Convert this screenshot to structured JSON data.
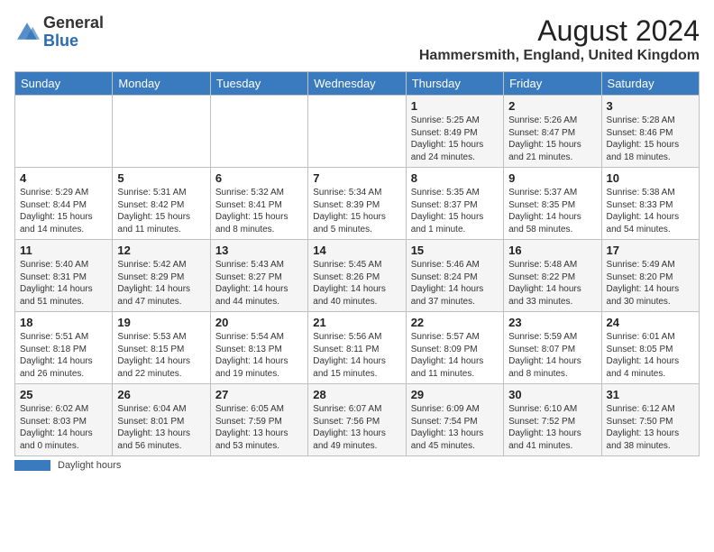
{
  "header": {
    "logo_general": "General",
    "logo_blue": "Blue",
    "month_year": "August 2024",
    "location": "Hammersmith, England, United Kingdom"
  },
  "days_of_week": [
    "Sunday",
    "Monday",
    "Tuesday",
    "Wednesday",
    "Thursday",
    "Friday",
    "Saturday"
  ],
  "footer": {
    "legend_label": "Daylight hours"
  },
  "weeks": [
    [
      {
        "day": "",
        "info": ""
      },
      {
        "day": "",
        "info": ""
      },
      {
        "day": "",
        "info": ""
      },
      {
        "day": "",
        "info": ""
      },
      {
        "day": "1",
        "info": "Sunrise: 5:25 AM\nSunset: 8:49 PM\nDaylight: 15 hours\nand 24 minutes."
      },
      {
        "day": "2",
        "info": "Sunrise: 5:26 AM\nSunset: 8:47 PM\nDaylight: 15 hours\nand 21 minutes."
      },
      {
        "day": "3",
        "info": "Sunrise: 5:28 AM\nSunset: 8:46 PM\nDaylight: 15 hours\nand 18 minutes."
      }
    ],
    [
      {
        "day": "4",
        "info": "Sunrise: 5:29 AM\nSunset: 8:44 PM\nDaylight: 15 hours\nand 14 minutes."
      },
      {
        "day": "5",
        "info": "Sunrise: 5:31 AM\nSunset: 8:42 PM\nDaylight: 15 hours\nand 11 minutes."
      },
      {
        "day": "6",
        "info": "Sunrise: 5:32 AM\nSunset: 8:41 PM\nDaylight: 15 hours\nand 8 minutes."
      },
      {
        "day": "7",
        "info": "Sunrise: 5:34 AM\nSunset: 8:39 PM\nDaylight: 15 hours\nand 5 minutes."
      },
      {
        "day": "8",
        "info": "Sunrise: 5:35 AM\nSunset: 8:37 PM\nDaylight: 15 hours\nand 1 minute."
      },
      {
        "day": "9",
        "info": "Sunrise: 5:37 AM\nSunset: 8:35 PM\nDaylight: 14 hours\nand 58 minutes."
      },
      {
        "day": "10",
        "info": "Sunrise: 5:38 AM\nSunset: 8:33 PM\nDaylight: 14 hours\nand 54 minutes."
      }
    ],
    [
      {
        "day": "11",
        "info": "Sunrise: 5:40 AM\nSunset: 8:31 PM\nDaylight: 14 hours\nand 51 minutes."
      },
      {
        "day": "12",
        "info": "Sunrise: 5:42 AM\nSunset: 8:29 PM\nDaylight: 14 hours\nand 47 minutes."
      },
      {
        "day": "13",
        "info": "Sunrise: 5:43 AM\nSunset: 8:27 PM\nDaylight: 14 hours\nand 44 minutes."
      },
      {
        "day": "14",
        "info": "Sunrise: 5:45 AM\nSunset: 8:26 PM\nDaylight: 14 hours\nand 40 minutes."
      },
      {
        "day": "15",
        "info": "Sunrise: 5:46 AM\nSunset: 8:24 PM\nDaylight: 14 hours\nand 37 minutes."
      },
      {
        "day": "16",
        "info": "Sunrise: 5:48 AM\nSunset: 8:22 PM\nDaylight: 14 hours\nand 33 minutes."
      },
      {
        "day": "17",
        "info": "Sunrise: 5:49 AM\nSunset: 8:20 PM\nDaylight: 14 hours\nand 30 minutes."
      }
    ],
    [
      {
        "day": "18",
        "info": "Sunrise: 5:51 AM\nSunset: 8:18 PM\nDaylight: 14 hours\nand 26 minutes."
      },
      {
        "day": "19",
        "info": "Sunrise: 5:53 AM\nSunset: 8:15 PM\nDaylight: 14 hours\nand 22 minutes."
      },
      {
        "day": "20",
        "info": "Sunrise: 5:54 AM\nSunset: 8:13 PM\nDaylight: 14 hours\nand 19 minutes."
      },
      {
        "day": "21",
        "info": "Sunrise: 5:56 AM\nSunset: 8:11 PM\nDaylight: 14 hours\nand 15 minutes."
      },
      {
        "day": "22",
        "info": "Sunrise: 5:57 AM\nSunset: 8:09 PM\nDaylight: 14 hours\nand 11 minutes."
      },
      {
        "day": "23",
        "info": "Sunrise: 5:59 AM\nSunset: 8:07 PM\nDaylight: 14 hours\nand 8 minutes."
      },
      {
        "day": "24",
        "info": "Sunrise: 6:01 AM\nSunset: 8:05 PM\nDaylight: 14 hours\nand 4 minutes."
      }
    ],
    [
      {
        "day": "25",
        "info": "Sunrise: 6:02 AM\nSunset: 8:03 PM\nDaylight: 14 hours\nand 0 minutes."
      },
      {
        "day": "26",
        "info": "Sunrise: 6:04 AM\nSunset: 8:01 PM\nDaylight: 13 hours\nand 56 minutes."
      },
      {
        "day": "27",
        "info": "Sunrise: 6:05 AM\nSunset: 7:59 PM\nDaylight: 13 hours\nand 53 minutes."
      },
      {
        "day": "28",
        "info": "Sunrise: 6:07 AM\nSunset: 7:56 PM\nDaylight: 13 hours\nand 49 minutes."
      },
      {
        "day": "29",
        "info": "Sunrise: 6:09 AM\nSunset: 7:54 PM\nDaylight: 13 hours\nand 45 minutes."
      },
      {
        "day": "30",
        "info": "Sunrise: 6:10 AM\nSunset: 7:52 PM\nDaylight: 13 hours\nand 41 minutes."
      },
      {
        "day": "31",
        "info": "Sunrise: 6:12 AM\nSunset: 7:50 PM\nDaylight: 13 hours\nand 38 minutes."
      }
    ]
  ]
}
